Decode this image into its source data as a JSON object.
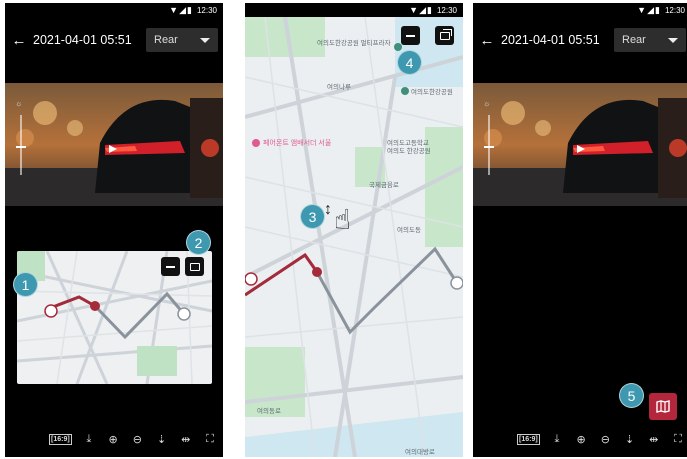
{
  "status_bar": {
    "time": "12:30",
    "icons": "▼◢▮"
  },
  "header": {
    "back_icon": "←",
    "date_time": "2021-04-01 05:51",
    "camera_select": "Rear"
  },
  "toolbar": {
    "items": [
      {
        "name": "aspect-ratio",
        "glyph": "[16:9]"
      },
      {
        "name": "download-icon",
        "glyph": "⤓"
      },
      {
        "name": "zoom-in-icon",
        "glyph": "⊕"
      },
      {
        "name": "zoom-out-icon",
        "glyph": "⊖"
      },
      {
        "name": "flip-vertical-icon",
        "glyph": "⇣"
      },
      {
        "name": "flip-horizontal-icon",
        "glyph": "⇹"
      },
      {
        "name": "fullscreen-icon",
        "glyph": "⛶"
      }
    ]
  },
  "callouts": {
    "c1": "1",
    "c2": "2",
    "c3": "3",
    "c4": "4",
    "c5": "5"
  },
  "map_labels": {
    "l1": "여의도한강공원 멀티프라자",
    "l2": "여의나루",
    "l3": "여의도한강공원",
    "l4": "페어몬트 앰배서더 서울",
    "l5": "여의도고등학교",
    "l6": "여의도 한강공원",
    "l7": "국제금융로",
    "l8": "여의도동",
    "l9": "여의동로",
    "l10": "여의대방로"
  },
  "colors": {
    "route_red": "#a52a3a",
    "route_gray": "#8a939c",
    "accent": "#3e98b0",
    "map_button": "#b3263b"
  }
}
